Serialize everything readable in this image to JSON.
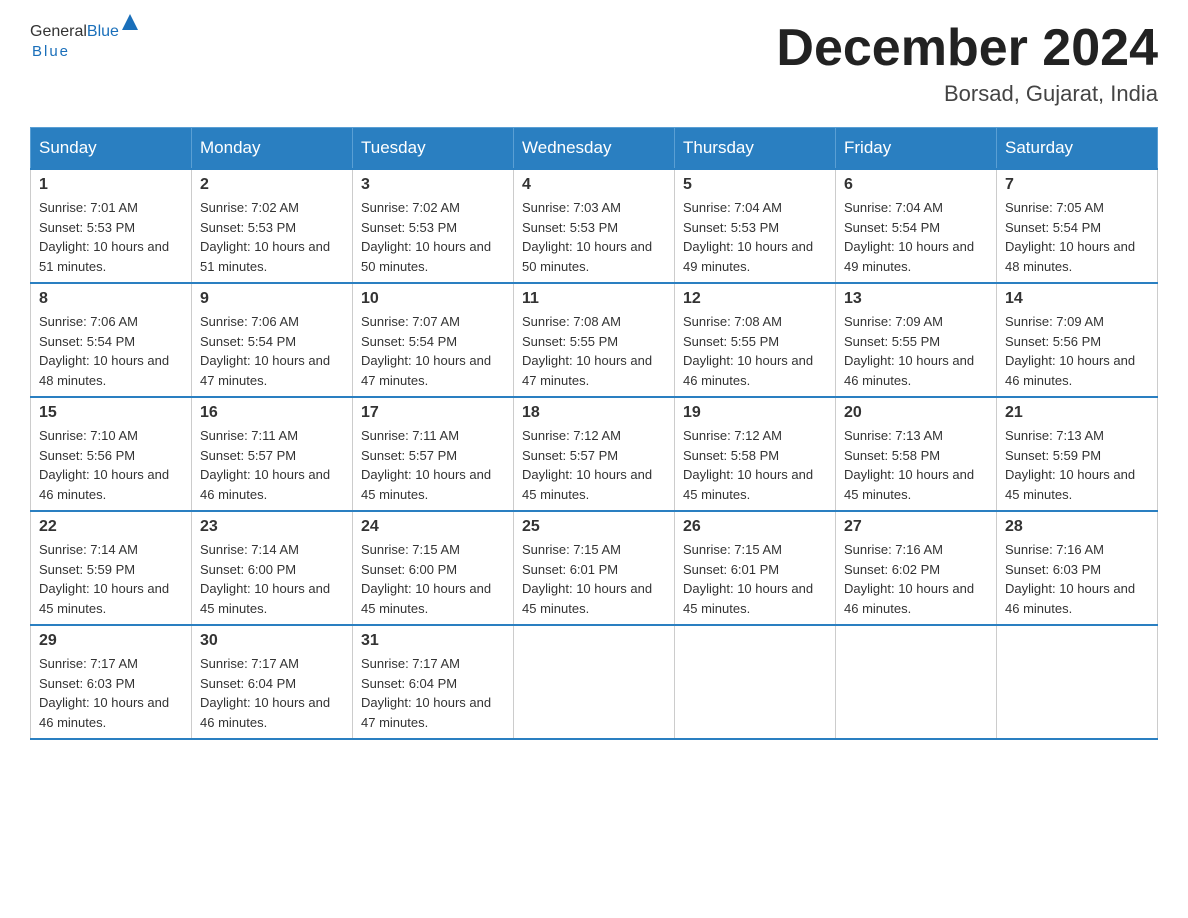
{
  "logo": {
    "general": "General",
    "blue": "Blue"
  },
  "title": {
    "month_year": "December 2024",
    "location": "Borsad, Gujarat, India"
  },
  "headers": [
    "Sunday",
    "Monday",
    "Tuesday",
    "Wednesday",
    "Thursday",
    "Friday",
    "Saturday"
  ],
  "weeks": [
    [
      {
        "day": "1",
        "sunrise": "7:01 AM",
        "sunset": "5:53 PM",
        "daylight": "10 hours and 51 minutes."
      },
      {
        "day": "2",
        "sunrise": "7:02 AM",
        "sunset": "5:53 PM",
        "daylight": "10 hours and 51 minutes."
      },
      {
        "day": "3",
        "sunrise": "7:02 AM",
        "sunset": "5:53 PM",
        "daylight": "10 hours and 50 minutes."
      },
      {
        "day": "4",
        "sunrise": "7:03 AM",
        "sunset": "5:53 PM",
        "daylight": "10 hours and 50 minutes."
      },
      {
        "day": "5",
        "sunrise": "7:04 AM",
        "sunset": "5:53 PM",
        "daylight": "10 hours and 49 minutes."
      },
      {
        "day": "6",
        "sunrise": "7:04 AM",
        "sunset": "5:54 PM",
        "daylight": "10 hours and 49 minutes."
      },
      {
        "day": "7",
        "sunrise": "7:05 AM",
        "sunset": "5:54 PM",
        "daylight": "10 hours and 48 minutes."
      }
    ],
    [
      {
        "day": "8",
        "sunrise": "7:06 AM",
        "sunset": "5:54 PM",
        "daylight": "10 hours and 48 minutes."
      },
      {
        "day": "9",
        "sunrise": "7:06 AM",
        "sunset": "5:54 PM",
        "daylight": "10 hours and 47 minutes."
      },
      {
        "day": "10",
        "sunrise": "7:07 AM",
        "sunset": "5:54 PM",
        "daylight": "10 hours and 47 minutes."
      },
      {
        "day": "11",
        "sunrise": "7:08 AM",
        "sunset": "5:55 PM",
        "daylight": "10 hours and 47 minutes."
      },
      {
        "day": "12",
        "sunrise": "7:08 AM",
        "sunset": "5:55 PM",
        "daylight": "10 hours and 46 minutes."
      },
      {
        "day": "13",
        "sunrise": "7:09 AM",
        "sunset": "5:55 PM",
        "daylight": "10 hours and 46 minutes."
      },
      {
        "day": "14",
        "sunrise": "7:09 AM",
        "sunset": "5:56 PM",
        "daylight": "10 hours and 46 minutes."
      }
    ],
    [
      {
        "day": "15",
        "sunrise": "7:10 AM",
        "sunset": "5:56 PM",
        "daylight": "10 hours and 46 minutes."
      },
      {
        "day": "16",
        "sunrise": "7:11 AM",
        "sunset": "5:57 PM",
        "daylight": "10 hours and 46 minutes."
      },
      {
        "day": "17",
        "sunrise": "7:11 AM",
        "sunset": "5:57 PM",
        "daylight": "10 hours and 45 minutes."
      },
      {
        "day": "18",
        "sunrise": "7:12 AM",
        "sunset": "5:57 PM",
        "daylight": "10 hours and 45 minutes."
      },
      {
        "day": "19",
        "sunrise": "7:12 AM",
        "sunset": "5:58 PM",
        "daylight": "10 hours and 45 minutes."
      },
      {
        "day": "20",
        "sunrise": "7:13 AM",
        "sunset": "5:58 PM",
        "daylight": "10 hours and 45 minutes."
      },
      {
        "day": "21",
        "sunrise": "7:13 AM",
        "sunset": "5:59 PM",
        "daylight": "10 hours and 45 minutes."
      }
    ],
    [
      {
        "day": "22",
        "sunrise": "7:14 AM",
        "sunset": "5:59 PM",
        "daylight": "10 hours and 45 minutes."
      },
      {
        "day": "23",
        "sunrise": "7:14 AM",
        "sunset": "6:00 PM",
        "daylight": "10 hours and 45 minutes."
      },
      {
        "day": "24",
        "sunrise": "7:15 AM",
        "sunset": "6:00 PM",
        "daylight": "10 hours and 45 minutes."
      },
      {
        "day": "25",
        "sunrise": "7:15 AM",
        "sunset": "6:01 PM",
        "daylight": "10 hours and 45 minutes."
      },
      {
        "day": "26",
        "sunrise": "7:15 AM",
        "sunset": "6:01 PM",
        "daylight": "10 hours and 45 minutes."
      },
      {
        "day": "27",
        "sunrise": "7:16 AM",
        "sunset": "6:02 PM",
        "daylight": "10 hours and 46 minutes."
      },
      {
        "day": "28",
        "sunrise": "7:16 AM",
        "sunset": "6:03 PM",
        "daylight": "10 hours and 46 minutes."
      }
    ],
    [
      {
        "day": "29",
        "sunrise": "7:17 AM",
        "sunset": "6:03 PM",
        "daylight": "10 hours and 46 minutes."
      },
      {
        "day": "30",
        "sunrise": "7:17 AM",
        "sunset": "6:04 PM",
        "daylight": "10 hours and 46 minutes."
      },
      {
        "day": "31",
        "sunrise": "7:17 AM",
        "sunset": "6:04 PM",
        "daylight": "10 hours and 47 minutes."
      },
      null,
      null,
      null,
      null
    ]
  ],
  "labels": {
    "sunrise": "Sunrise:",
    "sunset": "Sunset:",
    "daylight": "Daylight:"
  }
}
